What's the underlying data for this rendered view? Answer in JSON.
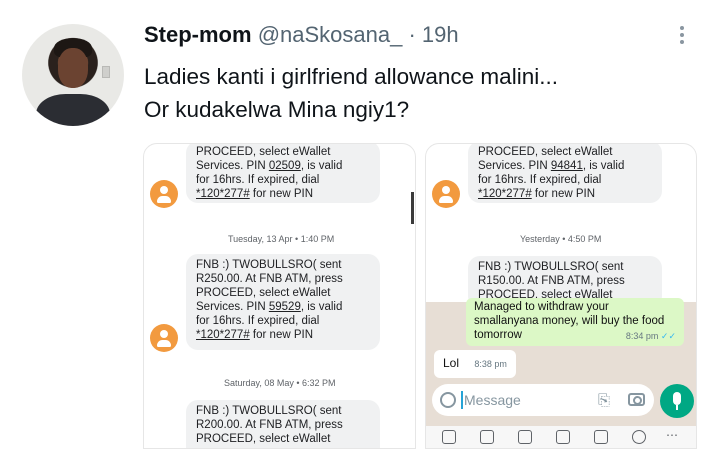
{
  "tweet": {
    "display_name": "Step-mom",
    "handle": "@naSkosana_",
    "separator": " · ",
    "time": "19h",
    "text_line1": "Ladies kanti i girlfriend allowance malini...",
    "text_line2": "Or kudakelwa Mina ngiy1?"
  },
  "left_screenshot": {
    "sms1": [
      "PROCEED, select eWallet",
      "Services. PIN ",
      "02509",
      ", is valid",
      "for 16hrs. If expired, dial",
      "*120*277#",
      " for new PIN"
    ],
    "date1": "Tuesday, 13 Apr • 1:40 PM",
    "sms2": [
      "FNB :) TWOBULLSRO( sent",
      "R250.00. At FNB ATM, press",
      "PROCEED, select eWallet",
      "Services. PIN ",
      "59529",
      ", is valid",
      "for 16hrs. If expired, dial",
      "*120*277#",
      " for new PIN"
    ],
    "date2": "Saturday, 08 May • 6:32 PM",
    "sms3": [
      "FNB :) TWOBULLSRO( sent",
      "R200.00. At FNB ATM, press",
      "PROCEED, select eWallet"
    ]
  },
  "right_screenshot": {
    "sms1": [
      "PROCEED, select eWallet",
      "Services. PIN ",
      "94841",
      ", is valid",
      "for 16hrs. If expired, dial",
      "*120*277#",
      " for new PIN"
    ],
    "date1": "Yesterday • 4:50 PM",
    "sms2": [
      "FNB :) TWOBULLSRO( sent",
      "R150.00. At FNB ATM, press",
      "PROCEED, select eWallet"
    ],
    "whatsapp": {
      "outgoing": [
        "Managed to withdraw your",
        "smallanyana money, will buy the food",
        "tomorrow"
      ],
      "outgoing_time": "8:34 pm",
      "incoming": "Lol",
      "incoming_time": "8:38 pm",
      "input_placeholder": "Message"
    }
  },
  "icons": [
    "more-icon",
    "person-icon",
    "emoji-icon",
    "attach-icon",
    "camera-icon",
    "mic-icon",
    "gif-icon",
    "sticker-icon",
    "clipboard-icon",
    "translate-icon",
    "pen-icon",
    "info-icon",
    "keyboard-more-icon"
  ]
}
